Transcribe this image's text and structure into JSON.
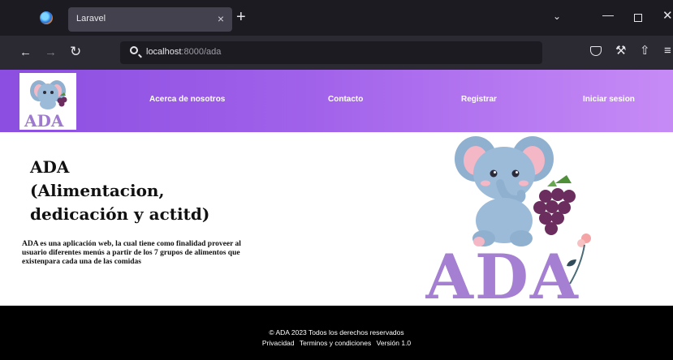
{
  "browser": {
    "tab_title": "Laravel",
    "tab_close": "×",
    "new_tab": "+",
    "url_host": "localhost",
    "url_rest": ":8000/ada",
    "icons": [
      "firefox-logo",
      "back-arrow",
      "forward-arrow",
      "reload",
      "search",
      "pocket",
      "wrench",
      "share",
      "menu"
    ]
  },
  "site": {
    "logo_text": "ADA",
    "nav": {
      "about": "Acerca de nosotros",
      "contact": "Contacto",
      "register": "Registrar",
      "login": "Iniciar sesion"
    },
    "header_gradient": [
      "#8b4ee0",
      "#c78bf6"
    ]
  },
  "hero": {
    "title_line1": "ADA",
    "title_line2": "(Alimentacion,",
    "title_line3": "dedicación y actitd)",
    "description": "ADA es una aplicación web, la cual tiene como finalidad proveer al usuario diferentes menús a partir de los 7 grupos de alimentos que existenpara cada una de las comidas",
    "art_text": "ADA",
    "art_color": "#a57fd1"
  },
  "footer": {
    "copyright": "© ADA 2023 Todos los derechos reservados",
    "privacy": "Privacidad",
    "terms": "Terminos y condiciones",
    "version": "Versión 1.0"
  }
}
